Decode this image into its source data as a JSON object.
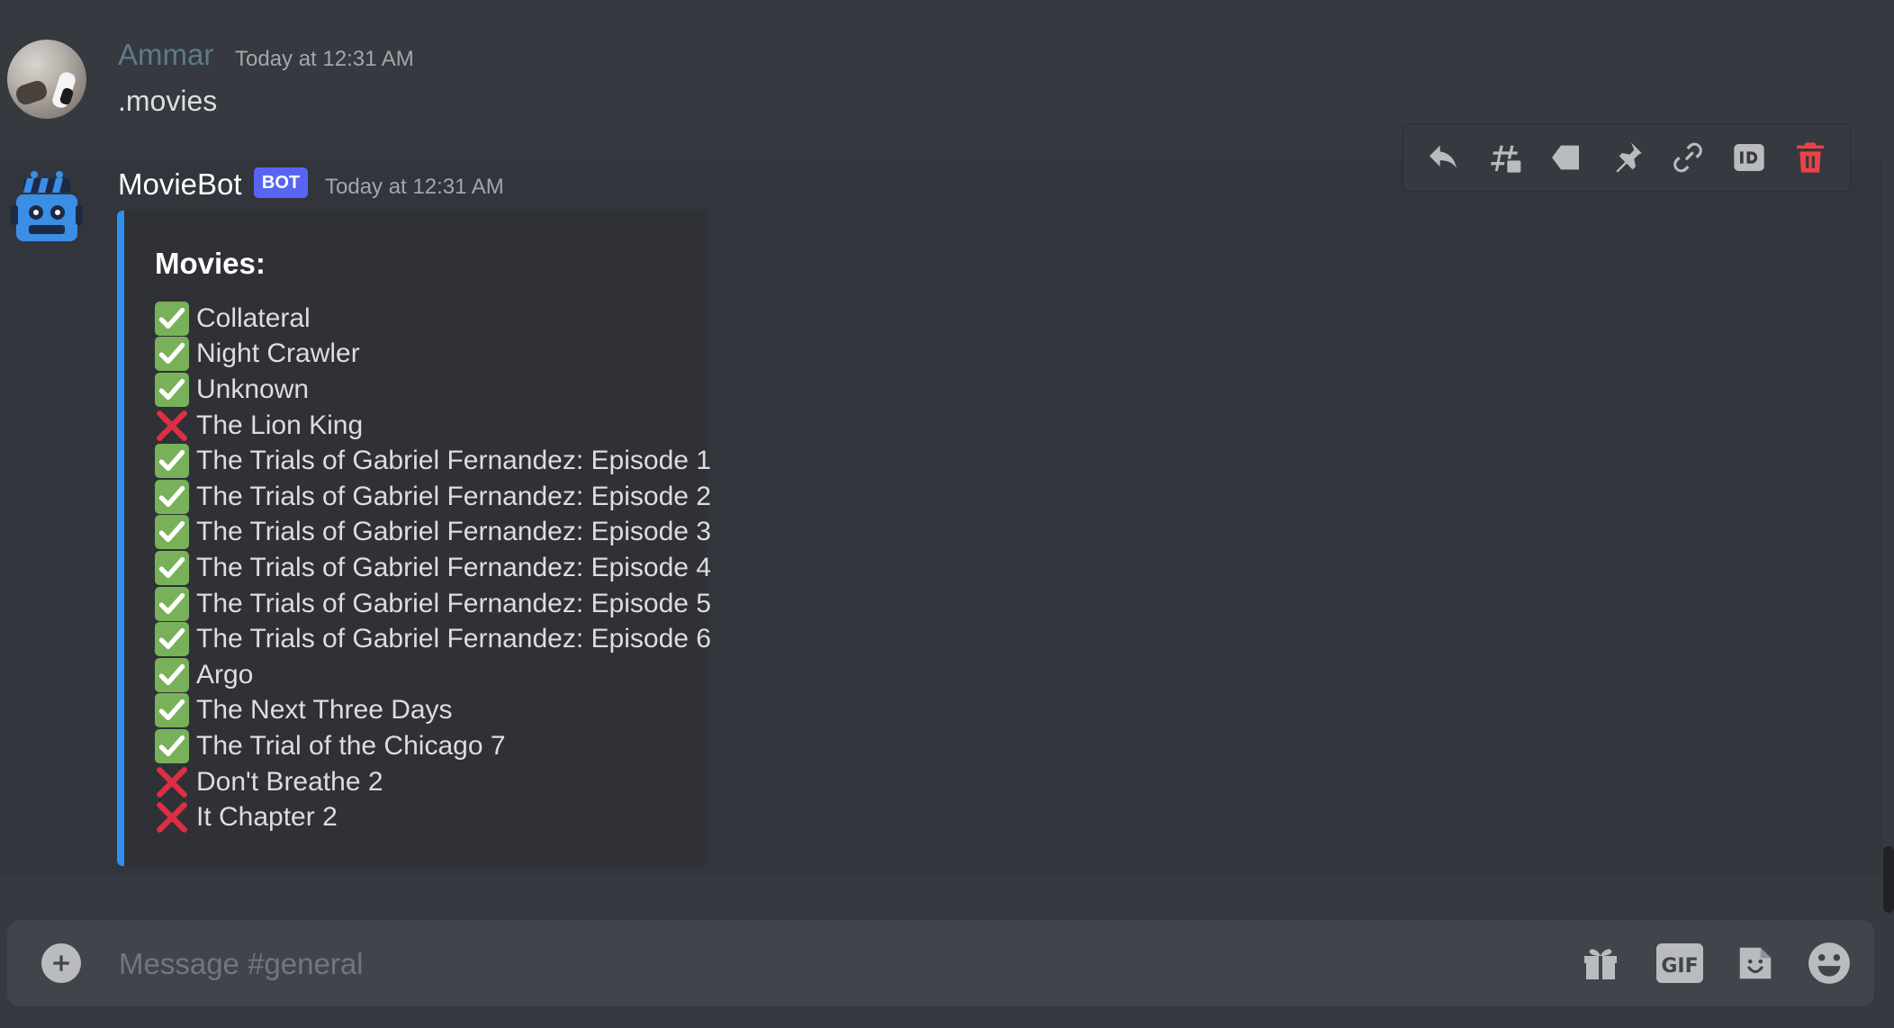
{
  "channel": "general",
  "messages": [
    {
      "author": "Ammar",
      "timestamp": "Today at 12:31 AM",
      "content": ".movies",
      "author_color": "#5c7b8a"
    },
    {
      "author": "MovieBot",
      "bot_tag": "BOT",
      "timestamp": "Today at 12:31 AM",
      "embed": {
        "title": "Movies:",
        "accent_color": "#2f8ff2",
        "items": [
          {
            "status": "check",
            "title": "Collateral"
          },
          {
            "status": "check",
            "title": "Night Crawler"
          },
          {
            "status": "check",
            "title": "Unknown"
          },
          {
            "status": "cross",
            "title": "The Lion King"
          },
          {
            "status": "check",
            "title": "The Trials of Gabriel Fernandez: Episode 1"
          },
          {
            "status": "check",
            "title": "The Trials of Gabriel Fernandez: Episode 2"
          },
          {
            "status": "check",
            "title": "The Trials of Gabriel Fernandez: Episode 3"
          },
          {
            "status": "check",
            "title": "The Trials of Gabriel Fernandez: Episode 4"
          },
          {
            "status": "check",
            "title": "The Trials of Gabriel Fernandez: Episode 5"
          },
          {
            "status": "check",
            "title": "The Trials of Gabriel Fernandez: Episode 6"
          },
          {
            "status": "check",
            "title": "Argo"
          },
          {
            "status": "check",
            "title": "The Next Three Days"
          },
          {
            "status": "check",
            "title": "The Trial of the Chicago 7"
          },
          {
            "status": "cross",
            "title": "Don't Breathe 2"
          },
          {
            "status": "cross",
            "title": "It Chapter 2"
          }
        ]
      }
    }
  ],
  "toolbar": {
    "actions": [
      "reply-icon",
      "thread-icon",
      "tag-icon",
      "pin-icon",
      "link-icon",
      "id-icon",
      "trash-icon"
    ]
  },
  "composer": {
    "placeholder": "Message #general",
    "value": "",
    "gif_label": "GIF"
  },
  "colors": {
    "background": "#36393f",
    "hover_background": "#32353b",
    "embed_background": "#2f3136",
    "bot_tag": "#5865f2",
    "check_green": "#78b159",
    "cross_red": "#dd2e44",
    "danger": "#ed4245"
  }
}
